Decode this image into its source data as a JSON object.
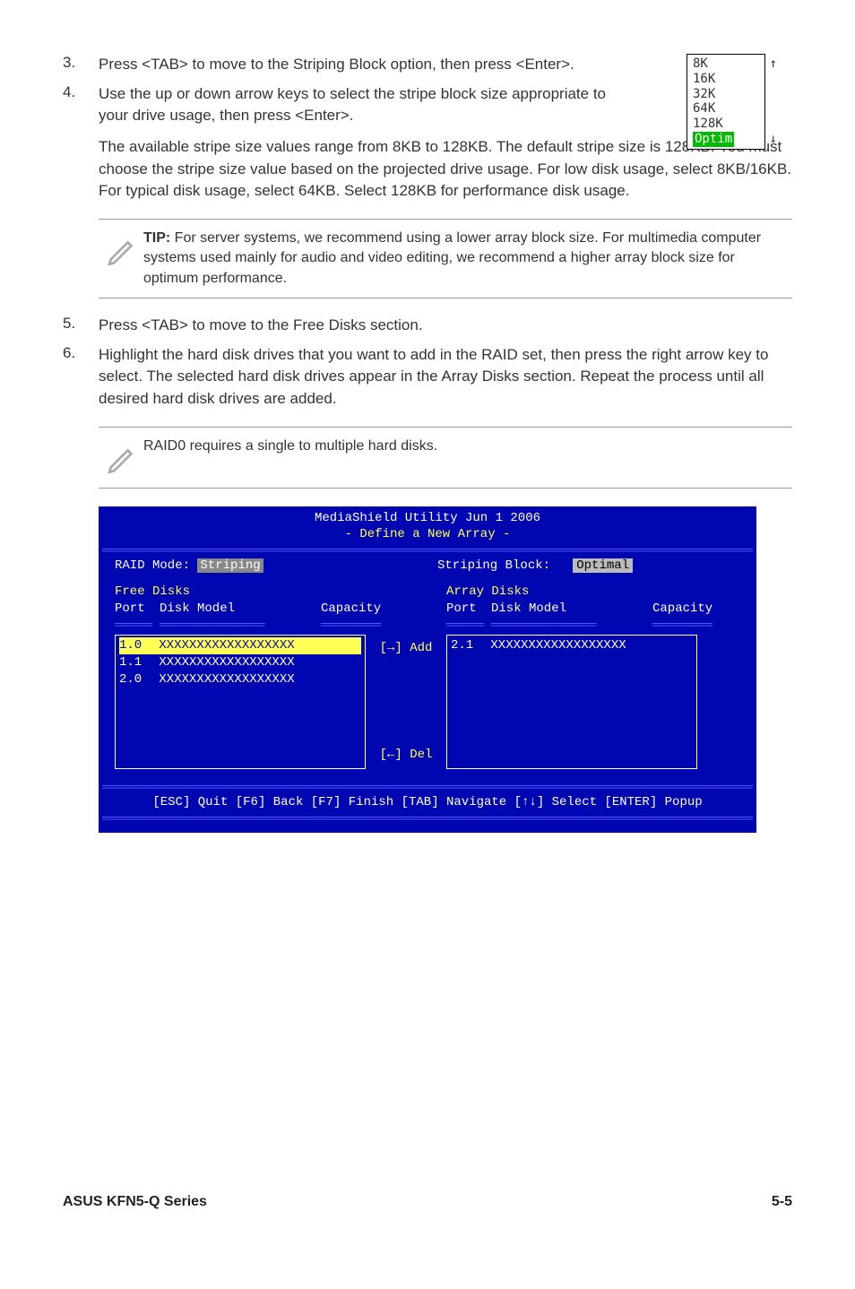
{
  "steps": {
    "s3": {
      "num": "3.",
      "text": "Press <TAB> to move to the Striping Block option, then press <Enter>."
    },
    "s4": {
      "num": "4.",
      "text": "Use the up or down arrow keys to select the stripe block size appropriate to your drive usage, then press <Enter>."
    },
    "s4_cont": "The available stripe size values range from 8KB to 128KB. The default stripe size is 128KB. You must choose the stripe size value based on the projected drive usage. For low disk usage, select 8KB/16KB. For typical disk usage, select 64KB. Select 128KB for performance disk usage.",
    "s5": {
      "num": "5.",
      "text": "Press <TAB> to move to the Free Disks section."
    },
    "s6": {
      "num": "6.",
      "text": "Highlight the hard disk drives that you want to add in the RAID set, then press the right arrow key to select. The selected hard disk drives appear in the Array Disks section. Repeat the process until all desired hard disk drives are added."
    }
  },
  "stripe_box": {
    "opts": [
      "8K",
      "16K",
      "32K",
      "64K",
      "128K"
    ],
    "selected": "Optim",
    "arrow_up": "↑",
    "arrow_down": "↓"
  },
  "tip": {
    "label": "TIP:",
    "text": " For server systems, we recommend using a lower array block size. For multimedia computer systems used mainly for audio and video editing, we recommend a higher array block size for optimum performance."
  },
  "note2": {
    "text": "RAID0 requires a single to multiple hard disks."
  },
  "bios": {
    "title": "MediaShield Utility   Jun  1 2006",
    "subtitle": "- Define a New Array -",
    "raid_mode_label": "RAID Mode:",
    "raid_mode_value": "Striping",
    "striping_block_label": "Striping Block:",
    "striping_block_value": "Optimal",
    "free_disks_label": "Free Disks",
    "array_disks_label": "Array Disks",
    "port_label": "Port",
    "disk_model_label": "Disk Model",
    "capacity_label": "Capacity",
    "add_label": "[→] Add",
    "del_label": "[←] Del",
    "free_rows": [
      {
        "port": "1.0",
        "model": "XXXXXXXXXXXXXXXXXX"
      },
      {
        "port": "1.1",
        "model": "XXXXXXXXXXXXXXXXXX"
      },
      {
        "port": "2.0",
        "model": "XXXXXXXXXXXXXXXXXX"
      }
    ],
    "array_rows": [
      {
        "port": "2.1",
        "model": "XXXXXXXXXXXXXXXXXX"
      }
    ],
    "footer_hint": "[ESC] Quit [F6] Back [F7] Finish [TAB] Navigate [↑↓] Select [ENTER] Popup"
  },
  "footer": {
    "left": "ASUS KFN5-Q Series",
    "right": "5-5"
  }
}
